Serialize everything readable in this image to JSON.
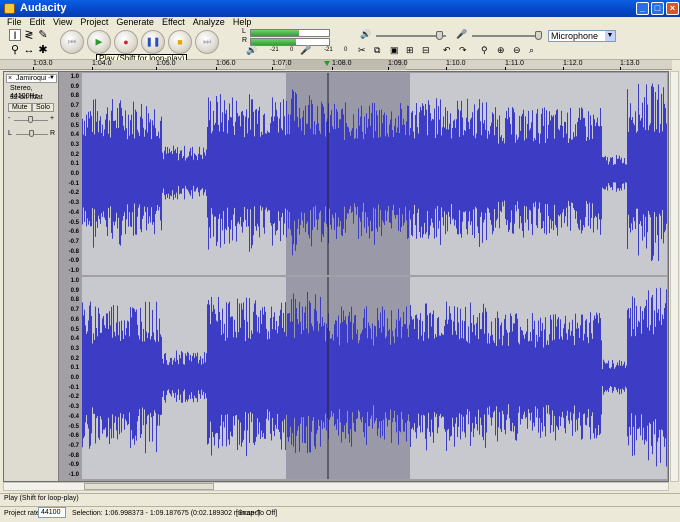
{
  "window": {
    "title": "Audacity",
    "min": "_",
    "max": "□",
    "close": "×"
  },
  "menu": [
    "File",
    "Edit",
    "View",
    "Project",
    "Generate",
    "Effect",
    "Analyze",
    "Help"
  ],
  "tools": {
    "select": "I",
    "envelope": "≷",
    "draw": "✎",
    "zoom": "⚲",
    "timeshift": "↔",
    "multi": "✱"
  },
  "transport": {
    "rewind": "⏮",
    "play": "▶",
    "record": "●",
    "pause": "❚❚",
    "stop": "■",
    "ffwd": "⏭"
  },
  "tooltip": "Play (Shift for loop-play)",
  "meter": {
    "left": "L",
    "right": "R",
    "db1": "-21",
    "db2": "0",
    "db3": "-21",
    "db4": "0",
    "level_left": 0.62,
    "level_right": 0.58
  },
  "input_source": "Microphone",
  "ruler_ticks": [
    "1:03.0",
    "1:04.0",
    "1:05.0",
    "1:06.0",
    "1:07.0",
    "1:08.0",
    "1:09.0",
    "1:10.0",
    "1:11.0",
    "1:12.0",
    "1:13.0"
  ],
  "track": {
    "name": "Jamiroqui - ",
    "format": "Stereo, 44100Hz",
    "bits": "32-bit float",
    "mute": "Mute",
    "solo": "Solo",
    "gain_minus": "-",
    "gain_plus": "+",
    "pan_left": "L",
    "pan_right": "R"
  },
  "vscale_labels": [
    "1.0",
    "0.9",
    "0.8",
    "0.7",
    "0.6",
    "0.5",
    "0.4",
    "0.3",
    "0.2",
    "0.1",
    "0.0",
    "-0.1",
    "-0.2",
    "-0.3",
    "-0.4",
    "-0.5",
    "-0.6",
    "-0.7",
    "-0.8",
    "-0.9",
    "-1.0"
  ],
  "status": {
    "message": "Play (Shift for loop-play)",
    "project_rate_label": "Project rate:",
    "project_rate": "44100",
    "selection": "Selection: 1:06.998373 - 1:09.187675 (0:02.189302 min:sec)",
    "snap": "[Snap-To Off]"
  },
  "colors": {
    "wave": "#3c3cc4",
    "selection": "#9999a8",
    "title": "#0447c9"
  }
}
